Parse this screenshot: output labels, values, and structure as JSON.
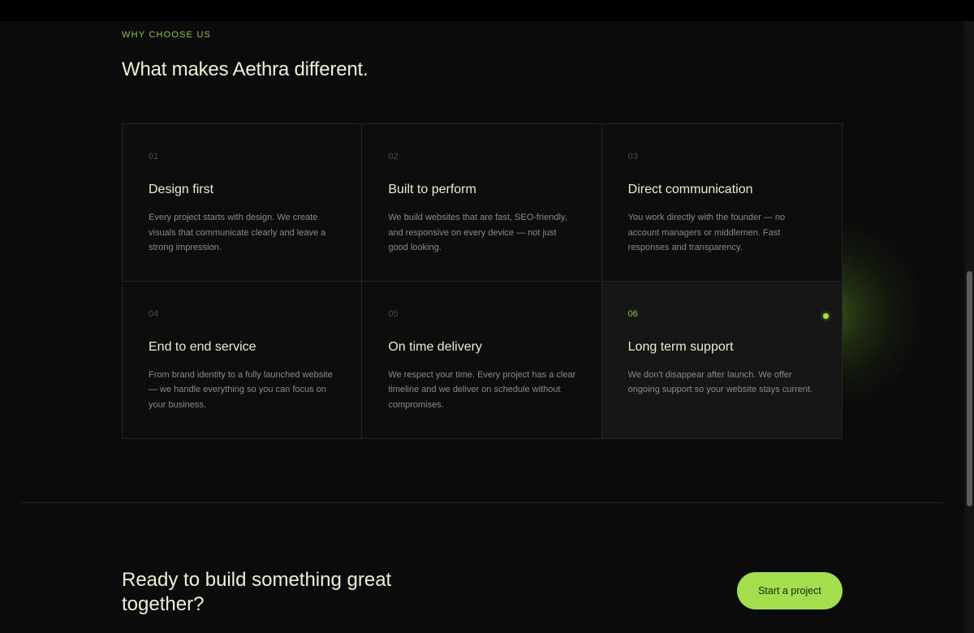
{
  "section": {
    "eyebrow": "WHY CHOOSE US",
    "title": "What makes Aethra different."
  },
  "features": [
    {
      "num": "01",
      "title": "Design first",
      "desc": "Every project starts with design. We create visuals that communicate clearly and leave a strong impression."
    },
    {
      "num": "02",
      "title": "Built to perform",
      "desc": "We build websites that are fast, SEO-friendly, and responsive on every device — not just good looking."
    },
    {
      "num": "03",
      "title": "Direct communication",
      "desc": "You work directly with the founder — no account managers or middlemen. Fast responses and transparency."
    },
    {
      "num": "04",
      "title": "End to end service",
      "desc": "From brand identity to a fully launched website — we handle everything so you can focus on your business."
    },
    {
      "num": "05",
      "title": "On time delivery",
      "desc": "We respect your time. Every project has a clear timeline and we deliver on schedule without compromises."
    },
    {
      "num": "06",
      "title": "Long term support",
      "desc": "We don't disappear after launch. We offer ongoing support so your website stays current."
    }
  ],
  "cta": {
    "heading": "Ready to build something great together?",
    "button": "Start a project"
  },
  "colors": {
    "accent": "#a4de4c",
    "background": "#0b0b0b",
    "heading": "#f0efd6"
  }
}
